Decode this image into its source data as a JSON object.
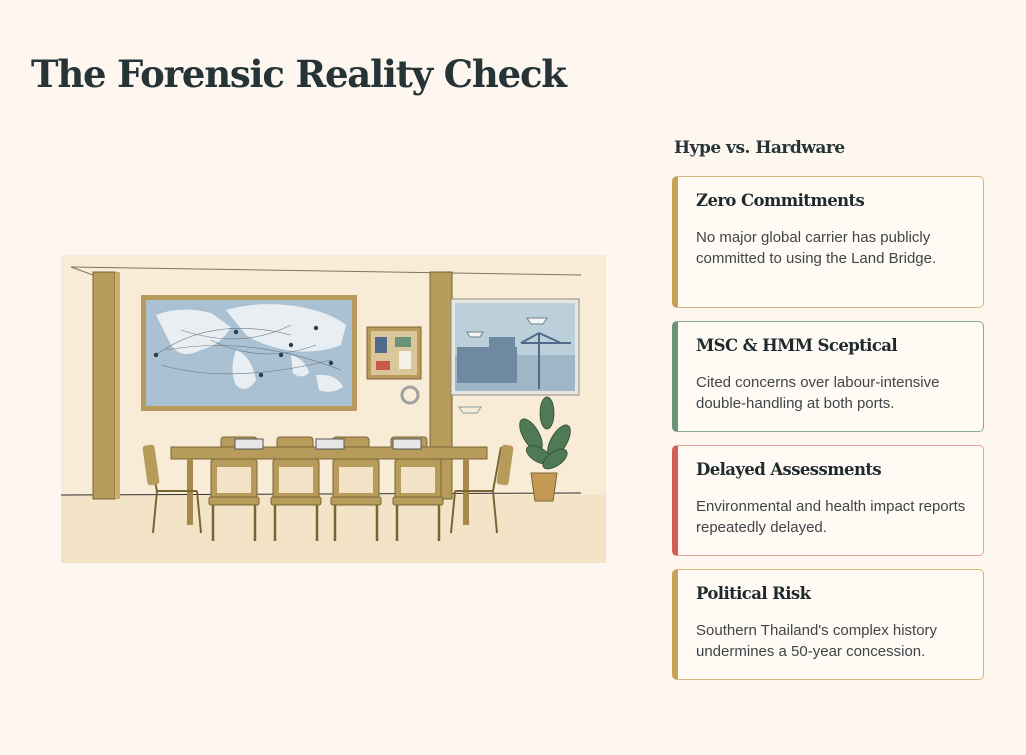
{
  "page": {
    "title": "The Forensic Reality Check"
  },
  "illustration": {
    "description_icon": "boardroom-illustration-icon",
    "colors": {
      "wood": "#b79b5a",
      "map_water": "#a9c1d2",
      "map_land": "#e8eef2",
      "wall": "#f8ecd6",
      "plant": "#4f7a55"
    }
  },
  "sidebar": {
    "heading": "Hype vs. Hardware",
    "cards": [
      {
        "title": "Zero Commitments",
        "text": "No major global carrier has publicly committed to using the Land Bridge.",
        "accent": "#c9a05a"
      },
      {
        "title": "MSC & HMM Sceptical",
        "text": "Cited concerns over labour-intensive double-handling at both ports.",
        "accent": "#6d9377"
      },
      {
        "title": "Delayed Assessments",
        "text": "Environmental and health impact reports repeatedly delayed.",
        "accent": "#d35e55"
      },
      {
        "title": "Political Risk",
        "text": "Southern Thailand's complex history undermines a 50-year concession.",
        "accent": "#c9a05a"
      }
    ]
  }
}
